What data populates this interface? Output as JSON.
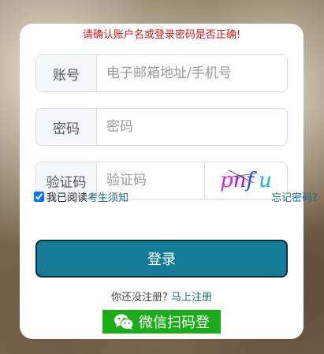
{
  "error_message": "请确认账户名或登录密码是否正确!",
  "account": {
    "label": "账号",
    "placeholder": "电子邮箱地址/手机号"
  },
  "password": {
    "label": "密码",
    "placeholder": "密码"
  },
  "captcha": {
    "label": "验证码",
    "placeholder": "验证码",
    "chars": [
      "p",
      "n",
      "f",
      "u"
    ]
  },
  "agree": {
    "prefix": "我已阅读",
    "link": "考生须知",
    "checked": true
  },
  "forgot_label": "忘记密码?",
  "login_label": "登录",
  "register": {
    "prompt": "你还没注册?",
    "link": "马上注册"
  },
  "wechat_label": "微信扫码登",
  "colors": {
    "error": "#e01919",
    "primary": "#147c99",
    "link": "#1a6b86",
    "wechat": "#1aad19"
  },
  "icons": {
    "wechat": "wechat-icon",
    "captcha": "captcha-image"
  }
}
